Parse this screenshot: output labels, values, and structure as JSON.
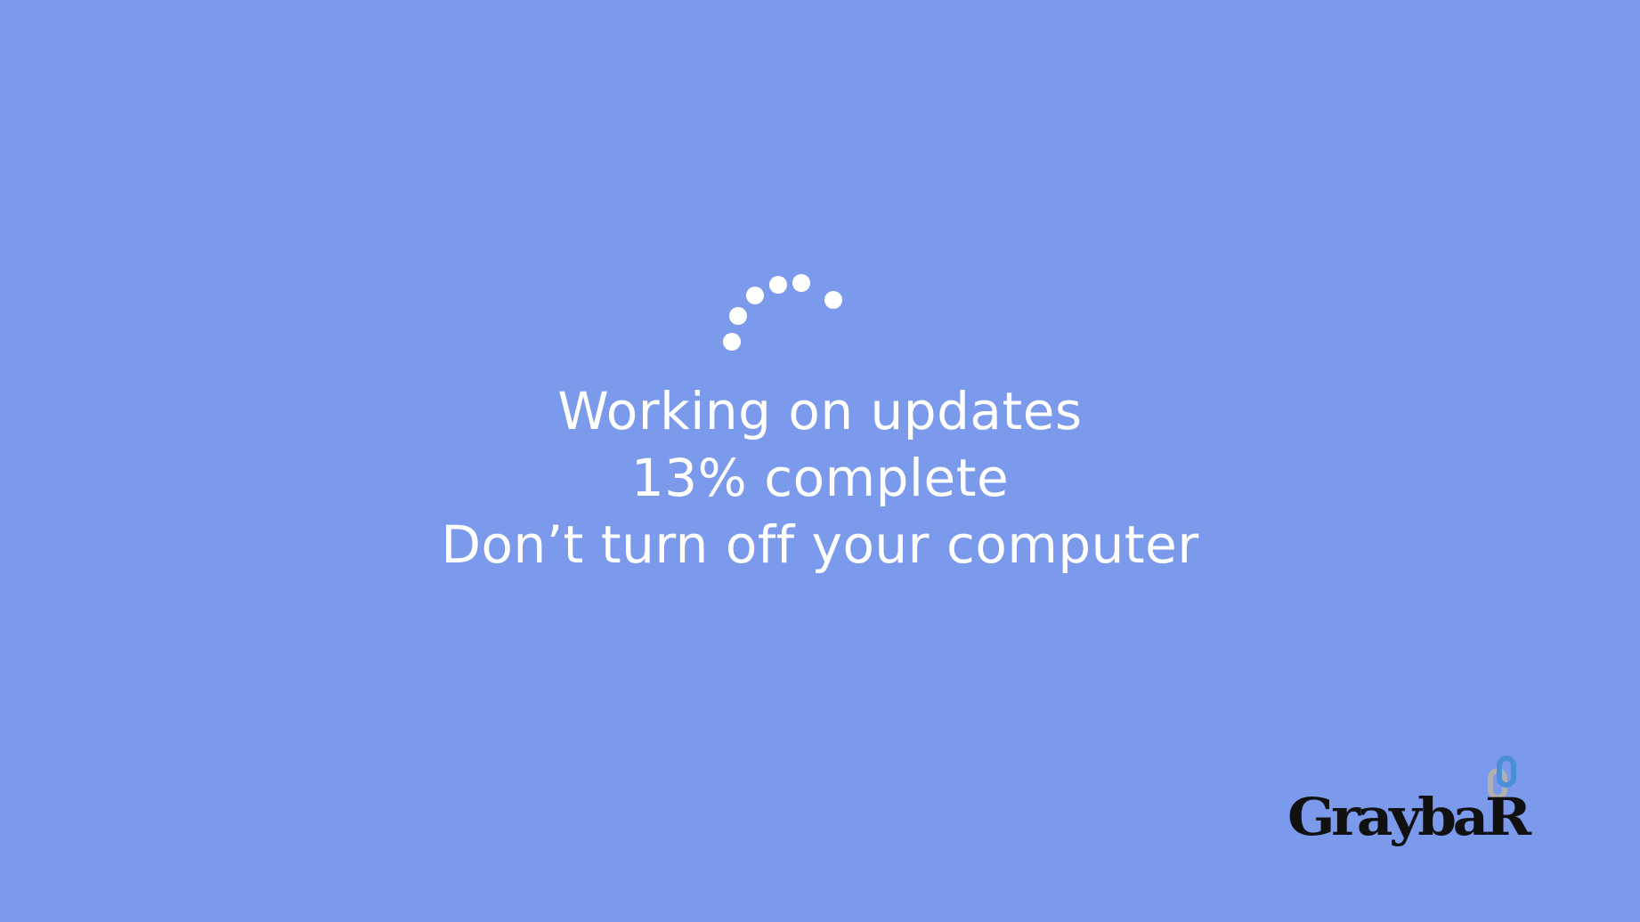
{
  "screen": {
    "background_color": "#7b9aec",
    "text_color": "#ffffff"
  },
  "update": {
    "title": "Working on updates",
    "progress_text": "13% complete",
    "progress_percent": 13,
    "warning": "Don’t turn off your computer"
  },
  "spinner": {
    "icon": "loading-dots-icon",
    "dot_color": "#ffffff"
  },
  "logo": {
    "text": "GraybaR",
    "icon": "chain-link-icon",
    "text_color": "#111111",
    "mark_colors": [
      "#4a8fd8",
      "#b0b0b0"
    ]
  }
}
